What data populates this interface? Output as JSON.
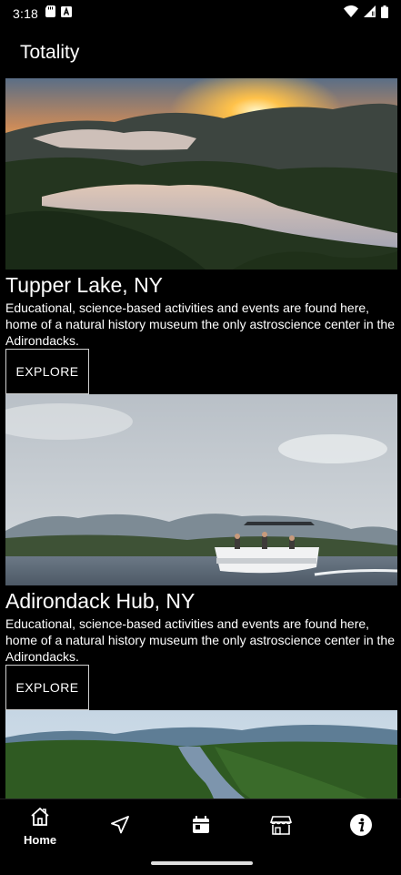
{
  "status_bar": {
    "time": "3:18",
    "left_icons": [
      "sd-card-icon",
      "a-badge-icon"
    ],
    "right_icons": [
      "wifi-icon",
      "signal-icon",
      "battery-icon"
    ]
  },
  "app": {
    "title": "Totality"
  },
  "cards": [
    {
      "title": "Tupper Lake, NY",
      "description": "Educational, science-based activities and events are found here, home of a natural history museum the only astroscience center in the Adirondacks.",
      "button_label": "EXPLORE",
      "image": "sunset-lake-mountains"
    },
    {
      "title": "Adirondack Hub, NY",
      "description": "Educational, science-based activities and events are found here, home of a natural history museum the only astroscience center in the Adirondacks.",
      "button_label": "EXPLORE",
      "image": "pontoon-boat-lake"
    },
    {
      "image": "aerial-lake-forest"
    }
  ],
  "bottom_nav": {
    "items": [
      {
        "label": "Home",
        "icon": "home-icon"
      },
      {
        "icon": "navigation-icon"
      },
      {
        "icon": "calendar-icon"
      },
      {
        "icon": "store-icon"
      },
      {
        "icon": "info-icon"
      }
    ]
  },
  "colors": {
    "background": "#000000",
    "text": "#ffffff",
    "button_border": "#cfcfcf"
  }
}
